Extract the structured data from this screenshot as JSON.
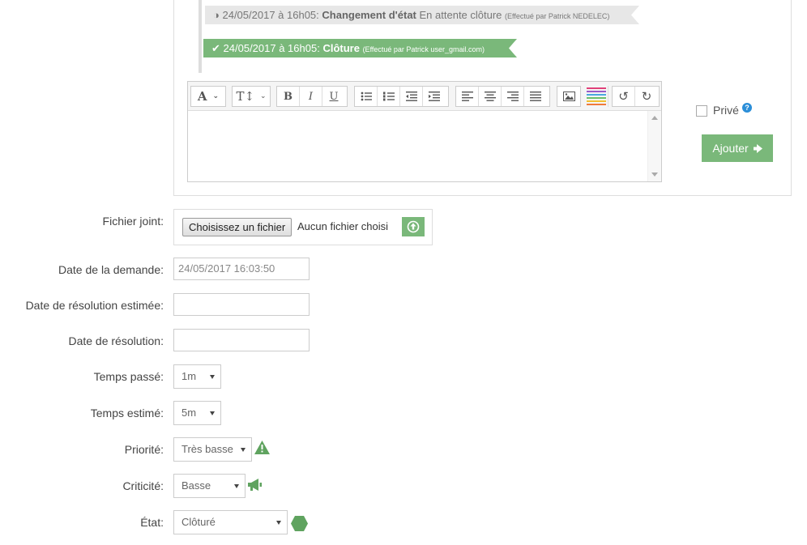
{
  "timeline": {
    "event1": {
      "date": "24/05/2017 à 16h05:",
      "title": "Changement d'état",
      "detail": "En attente clôture",
      "by": "(Effectué par Patrick NEDELEC)"
    },
    "event2": {
      "date": "24/05/2017 à 16h05:",
      "title": "Clôture",
      "by": "(Effectué par Patrick user_gmail.com)"
    }
  },
  "editor": {
    "font_label": "A",
    "size_label": "T↕",
    "bold": "B",
    "italic": "I",
    "underline": "U"
  },
  "comment": {
    "private_label": "Privé",
    "help_glyph": "?",
    "add_label": "Ajouter"
  },
  "form": {
    "attachment": {
      "label": "Fichier joint:",
      "choose_label": "Choisissez un fichier",
      "no_file": "Aucun fichier choisi"
    },
    "request_date": {
      "label": "Date de la demande:",
      "value": "24/05/2017 16:03:50"
    },
    "estimated_resolution": {
      "label": "Date de résolution estimée:",
      "value": ""
    },
    "resolution_date": {
      "label": "Date de résolution:",
      "value": ""
    },
    "time_spent": {
      "label": "Temps passé:",
      "value": "1m"
    },
    "time_estimated": {
      "label": "Temps estimé:",
      "value": "5m"
    },
    "priority": {
      "label": "Priorité:",
      "value": "Très basse"
    },
    "criticality": {
      "label": "Criticité:",
      "value": "Basse"
    },
    "state": {
      "label": "État:",
      "value": "Clôturé"
    }
  },
  "colors": {
    "accent_green": "#7ab87a",
    "help_blue": "#2b8ed8"
  }
}
